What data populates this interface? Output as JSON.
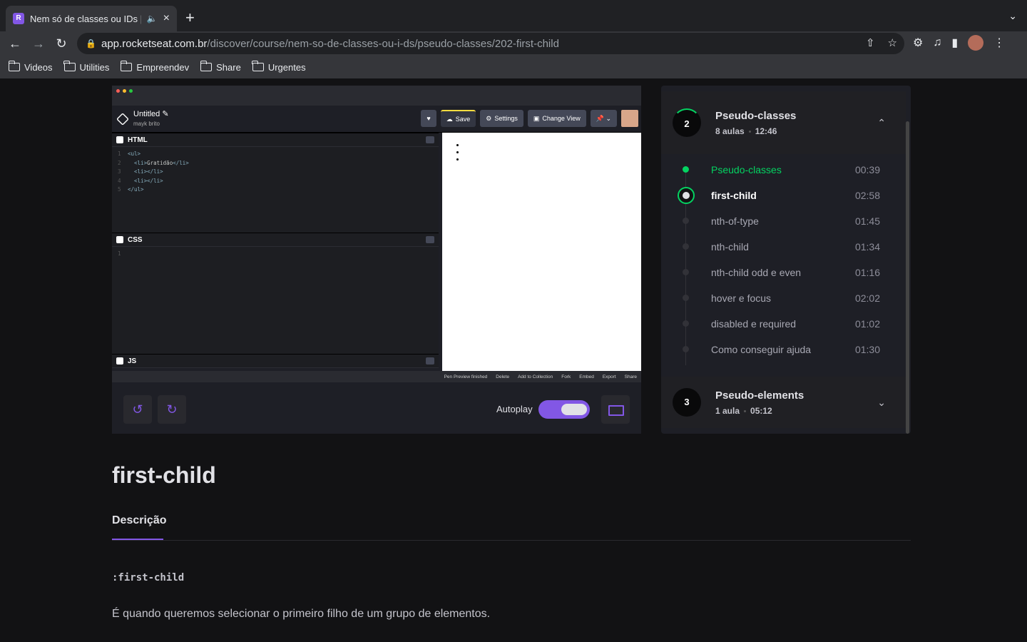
{
  "browser": {
    "tab_title": "Nem só de classes ou IDs |",
    "url_host": "app.rocketseat.com.br",
    "url_path": "/discover/course/nem-so-de-classes-ou-i-ds/pseudo-classes/202-first-child",
    "bookmarks": [
      "Videos",
      "Utilities",
      "Empreendev",
      "Share",
      "Urgentes"
    ]
  },
  "codepen": {
    "pen_title": "Untitled",
    "author": "mayk brito",
    "save": "Save",
    "settings": "Settings",
    "change_view": "Change View",
    "html_label": "HTML",
    "css_label": "CSS",
    "js_label": "JS",
    "footer_items": [
      "Pen Preview finished",
      "Delete",
      "Add to Collection",
      "Fork",
      "Embed",
      "Export",
      "Share"
    ]
  },
  "controls": {
    "autoplay_label": "Autoplay",
    "autoplay_on": true
  },
  "sidebar": {
    "module_current": {
      "number": "2",
      "title": "Pseudo-classes",
      "lessons_count": "8 aulas",
      "duration": "12:46"
    },
    "lessons": [
      {
        "name": "Pseudo-classes",
        "time": "00:39",
        "state": "done"
      },
      {
        "name": "first-child",
        "time": "02:58",
        "state": "current"
      },
      {
        "name": "nth-of-type",
        "time": "01:45",
        "state": "pending"
      },
      {
        "name": "nth-child",
        "time": "01:34",
        "state": "pending"
      },
      {
        "name": "nth-child odd e even",
        "time": "01:16",
        "state": "pending"
      },
      {
        "name": "hover e focus",
        "time": "02:02",
        "state": "pending"
      },
      {
        "name": "disabled e required",
        "time": "01:02",
        "state": "pending"
      },
      {
        "name": "Como conseguir ajuda",
        "time": "01:30",
        "state": "pending"
      }
    ],
    "module_next": {
      "number": "3",
      "title": "Pseudo-elements",
      "lessons_count": "1 aula",
      "duration": "05:12"
    }
  },
  "lesson": {
    "title": "first-child",
    "tab_description": "Descrição",
    "code_snippet": ":first-child",
    "description": "É quando queremos selecionar o primeiro filho de um grupo de elementos."
  },
  "colors": {
    "accent": "#8257e5",
    "green": "#04d361",
    "bg": "#121214"
  }
}
